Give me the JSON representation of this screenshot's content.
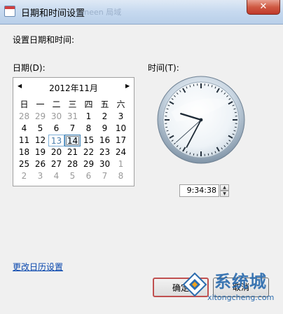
{
  "window": {
    "title": "日期和时间设置",
    "background_text": "Juneen 局域"
  },
  "header": {
    "prompt": "设置日期和时间:"
  },
  "date": {
    "label": "日期(D):",
    "calendar": {
      "month_title": "2012年11月",
      "weekdays": [
        "日",
        "一",
        "二",
        "三",
        "四",
        "五",
        "六"
      ],
      "weeks": [
        [
          "28",
          "29",
          "30",
          "31",
          "1",
          "2",
          "3"
        ],
        [
          "4",
          "5",
          "6",
          "7",
          "8",
          "9",
          "10"
        ],
        [
          "11",
          "12",
          "13",
          "14",
          "15",
          "16",
          "17"
        ],
        [
          "18",
          "19",
          "20",
          "21",
          "22",
          "23",
          "24"
        ],
        [
          "25",
          "26",
          "27",
          "28",
          "29",
          "30",
          "1"
        ],
        [
          "2",
          "3",
          "4",
          "5",
          "6",
          "7",
          "8"
        ]
      ],
      "selected_day": "14",
      "today_day": "13"
    }
  },
  "time": {
    "label": "时间(T):",
    "value": "9:34:38",
    "clock": {
      "hour": 9,
      "minute": 34,
      "second": 38
    }
  },
  "links": {
    "change_calendar": "更改日历设置"
  },
  "buttons": {
    "ok_label": "确定",
    "cancel_label": "取消"
  },
  "watermark": {
    "brand": "系统城",
    "domain": "xitongcheng.com"
  },
  "colors": {
    "titlebar": "#c6d9ef",
    "close_button": "#c0392b",
    "link": "#0645ad",
    "selected_border": "#3c7fb1",
    "watermark": "#2c6cae"
  },
  "icons": {
    "close": "close-icon",
    "prev": "triangle-left-icon",
    "next": "triangle-right-icon",
    "spin_up": "caret-up-icon",
    "spin_down": "caret-down-icon"
  }
}
